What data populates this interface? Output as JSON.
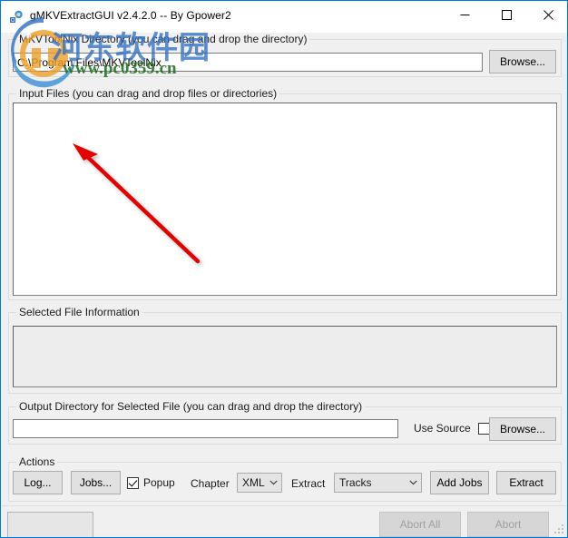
{
  "window": {
    "title": "gMKVExtractGUI v2.4.2.0 -- By Gpower2",
    "app_icon": "gear-app-icon",
    "minimize_label": "—",
    "maximize_label": "□",
    "close_label": "✕",
    "accent_color": "#0078d7",
    "background_color": "#f0f0f0"
  },
  "mkvtoolnix_dir": {
    "group_label": "MKVToolNix Directory (you can drag and drop the directory)",
    "path_value": "C:\\Program Files\\MKVToolNix",
    "path_placeholder": "",
    "browse_label": "Browse..."
  },
  "input_files": {
    "group_label": "Input Files (you can drag and drop files or directories)",
    "items": []
  },
  "selected_file_information": {
    "group_label": "Selected File Information",
    "text": ""
  },
  "output_directory": {
    "group_label": "Output Directory for Selected File (you can drag and drop the directory)",
    "path_value": "",
    "path_placeholder": "",
    "use_source_label": "Use Source",
    "use_source_checked": false,
    "browse_label": "Browse..."
  },
  "actions": {
    "group_label": "Actions",
    "log_label": "Log...",
    "jobs_label": "Jobs...",
    "popup_label": "Popup",
    "popup_checked": true,
    "chapter_label": "Chapter",
    "chapter_value": "XML",
    "chapter_options": [
      "XML"
    ],
    "extract_label": "Extract",
    "extract_type_value": "Tracks",
    "extract_type_options": [
      "Tracks"
    ],
    "add_jobs_label": "Add Jobs",
    "extract_button_label": "Extract"
  },
  "statusbar": {
    "progress_text": "",
    "abort_all_label": "Abort All",
    "abort_label": "Abort",
    "abort_all_enabled": false,
    "abort_enabled": false,
    "resize_grip": "resize-grip-icon"
  },
  "watermark": {
    "chinese_text": "河东软件园",
    "url_text": "www.pc0359.cn",
    "logo": "circular-logo"
  },
  "annotation": {
    "arrow": "red-arrow-pointer"
  }
}
